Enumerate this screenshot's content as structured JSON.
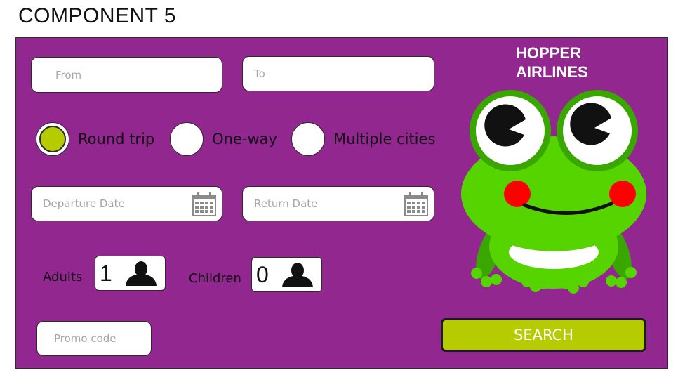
{
  "heading": "COMPONENT 5",
  "brand": {
    "line1": "HOPPER",
    "line2": "AIRLINES"
  },
  "fields": {
    "from_placeholder": "From",
    "to_placeholder": "To",
    "departure_placeholder": "Departure Date",
    "return_placeholder": "Return Date",
    "promo_placeholder": "Promo code"
  },
  "trip_type": {
    "options": [
      "Round trip",
      "One-way",
      "Multiple cities"
    ],
    "selected": "Round trip"
  },
  "passengers": {
    "adults_label": "Adults",
    "adults_value": "1",
    "children_label": "Children",
    "children_value": "0"
  },
  "search_label": "SEARCH",
  "colors": {
    "panel": "#91278f",
    "accent": "#b7cc00",
    "frog_green": "#55d400"
  },
  "icons": [
    "calendar-icon",
    "person-icon",
    "frog-mascot"
  ]
}
